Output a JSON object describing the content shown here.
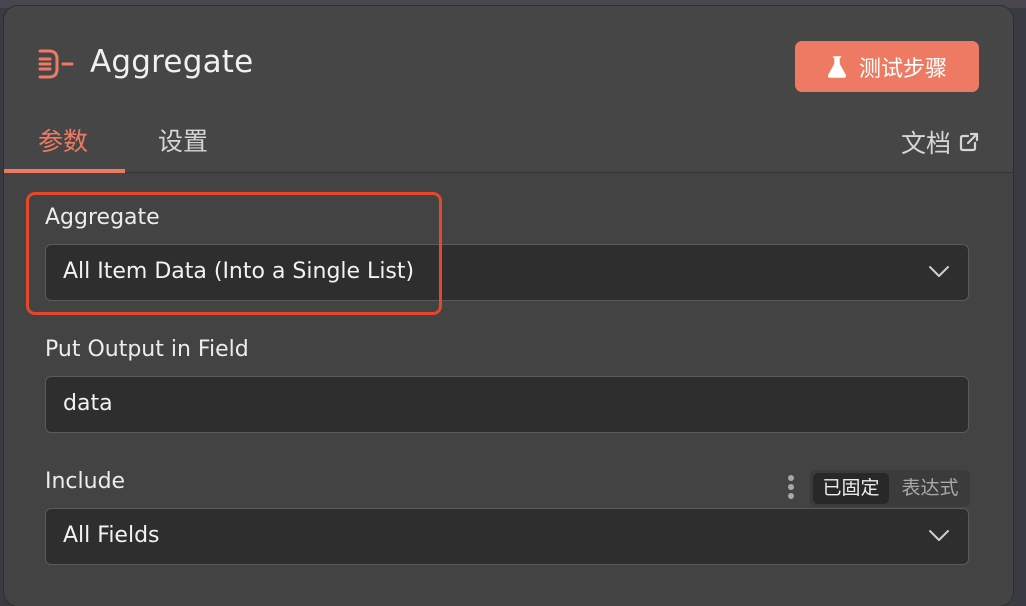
{
  "header": {
    "title": "Aggregate",
    "node_icon": "aggregate-icon",
    "test_button_label": "测试步骤",
    "test_button_icon": "flask-icon",
    "accent_color": "#ee7a63"
  },
  "tabs": [
    {
      "label": "参数",
      "active": true
    },
    {
      "label": "设置",
      "active": false
    }
  ],
  "docs": {
    "label": "文档",
    "icon": "external-link-icon"
  },
  "fields": {
    "aggregate": {
      "label": "Aggregate",
      "value": "All Item Data (Into a Single List)",
      "highlight_color": "#e4472b"
    },
    "output_field": {
      "label": "Put Output in Field",
      "value": "data"
    },
    "include": {
      "label": "Include",
      "value": "All Fields",
      "mode_options": [
        "已固定",
        "表达式"
      ],
      "mode_selected": "已固定"
    }
  }
}
